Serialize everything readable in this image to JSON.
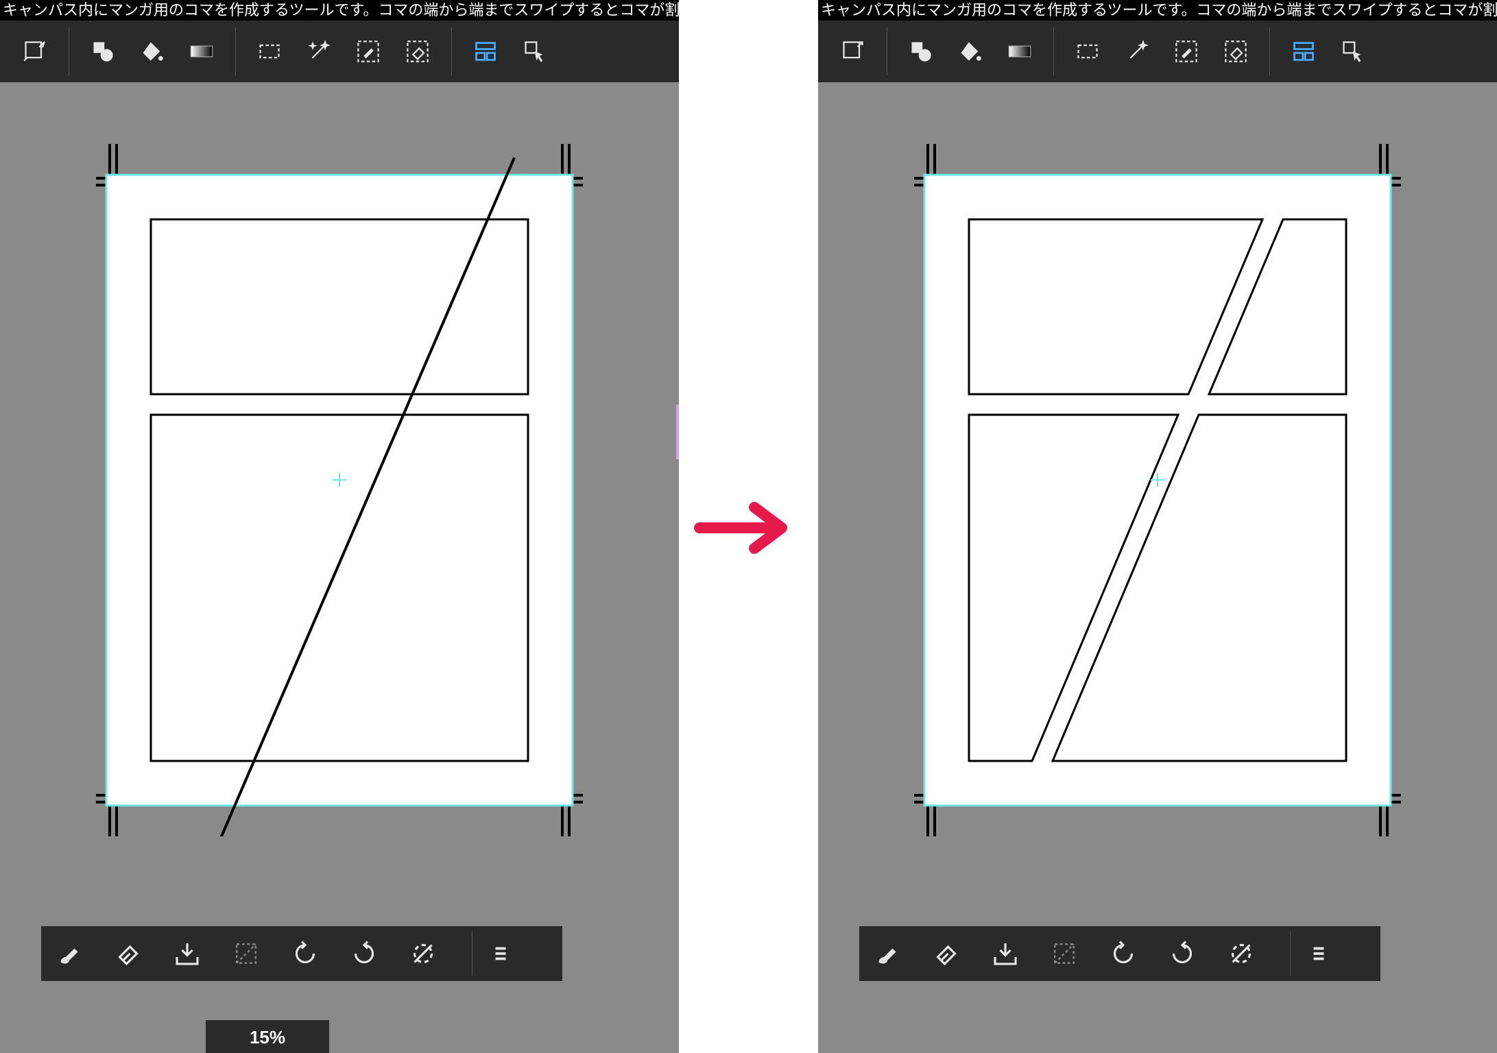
{
  "help_text": "キャンパス内にマンガ用のコマを作成するツールです。コマの端から端までスワイプするとコマが割",
  "zoom": "15%",
  "topbar": {
    "transform": "変形",
    "shapes": "図形",
    "bucket": "塗りつぶし",
    "gradient": "グラデーション",
    "marquee": "選択",
    "wand": "自動選択",
    "brush_select": "ブラシ選択",
    "eraser_select": "消去選択",
    "frame": "コマ割り",
    "pointer": "操作"
  },
  "bottombar": {
    "brush": "ブラシ",
    "eraser": "消しゴム",
    "tray": "保存",
    "marquee": "選択",
    "undo": "元に戻す",
    "redo": "やり直し",
    "reset_rotation": "回転リセット",
    "menu": "メニュー"
  },
  "canvas": {
    "outer_border_color": "#6ee7e7",
    "crop_mark_color": "#000000"
  }
}
